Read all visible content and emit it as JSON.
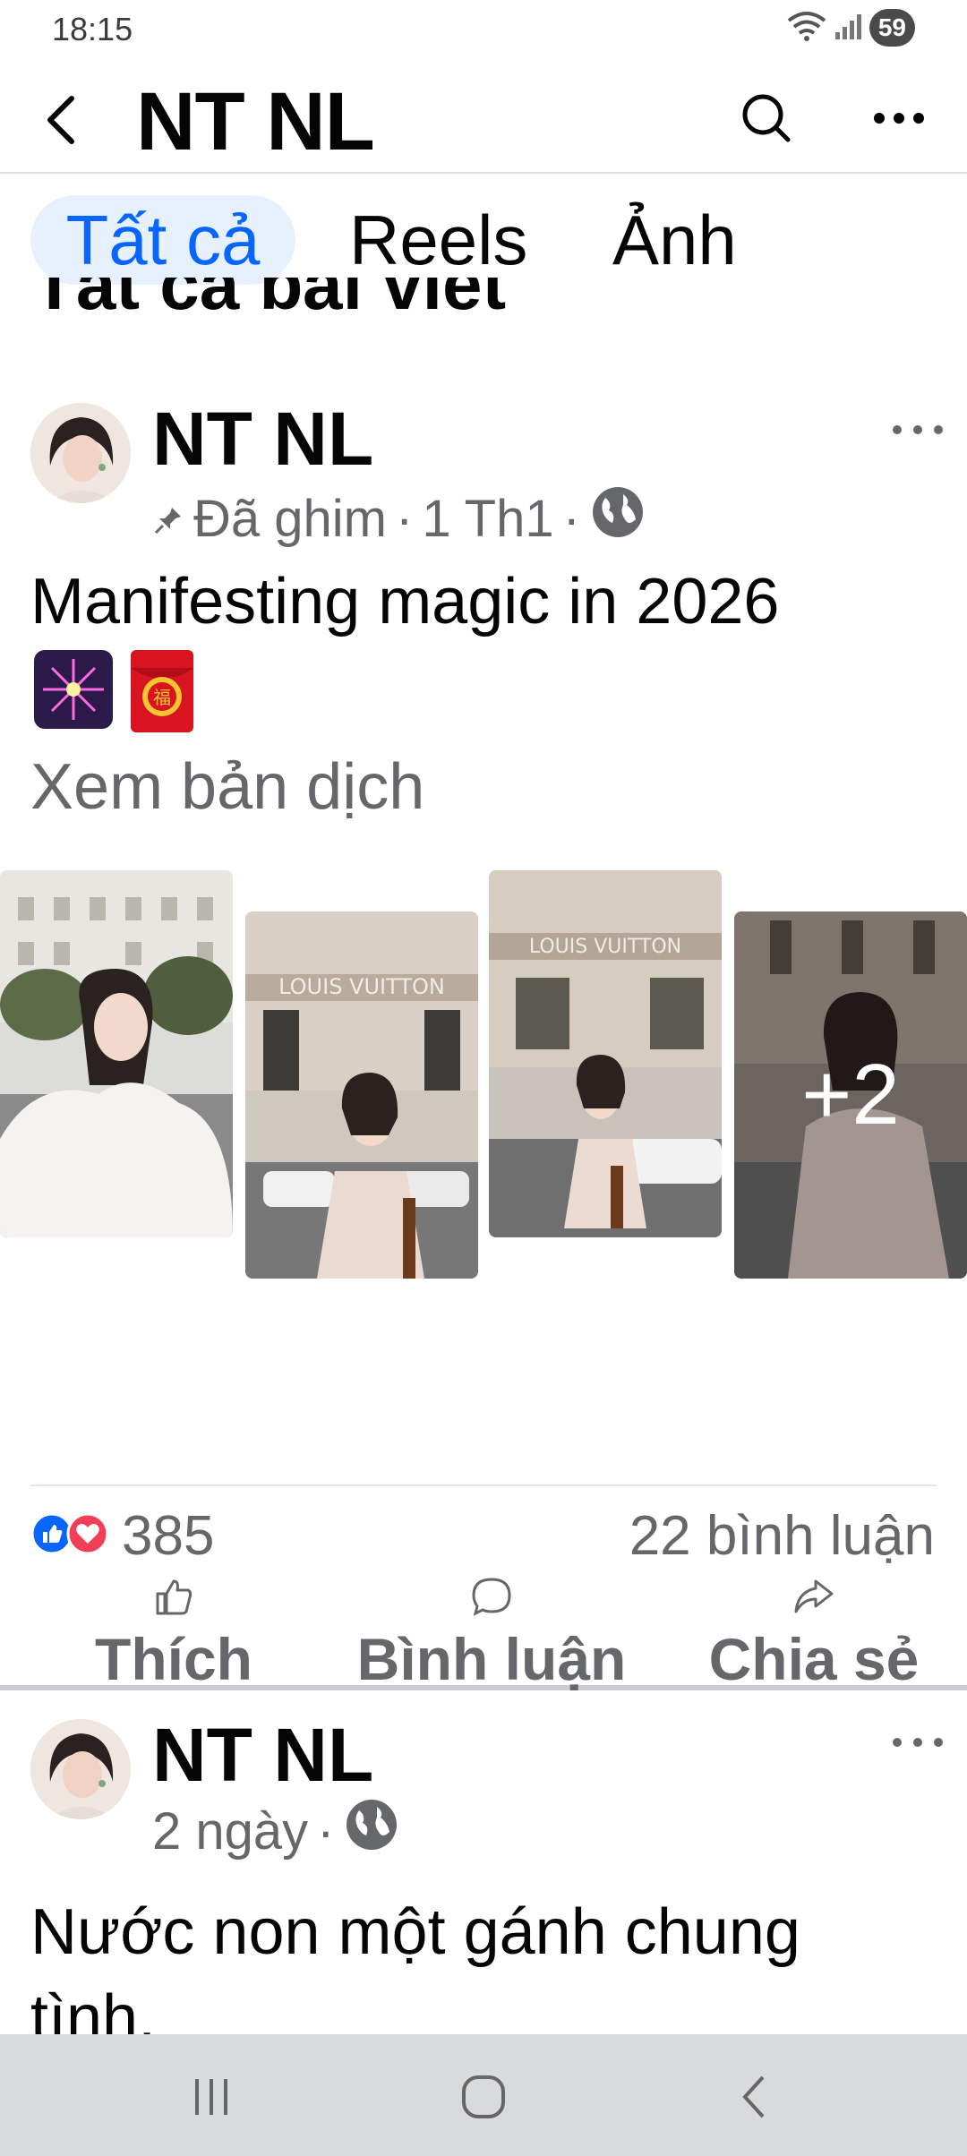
{
  "status": {
    "time": "18:15",
    "battery": "59"
  },
  "header": {
    "title": "NT NL"
  },
  "tabs": [
    {
      "label": "Tất cả"
    },
    {
      "label": "Reels"
    },
    {
      "label": "Ảnh"
    }
  ],
  "section": {
    "title": "Tất cả bài viết"
  },
  "posts": [
    {
      "author": "NT NL",
      "pinned": "Đã ghim",
      "time": "1 Th1",
      "sep": "·",
      "text": "Manifesting magic in 2026",
      "emojis": [
        "fireworks-emoji",
        "red-envelope-emoji"
      ],
      "translate": "Xem bản dịch",
      "more_photos": "+2",
      "reaction_count": "385",
      "comment_count": "22 bình luận",
      "actions": {
        "like": "Thích",
        "comment": "Bình luận",
        "share": "Chia sẻ"
      }
    },
    {
      "author": "NT NL",
      "time": "2 ngày",
      "sep": "·",
      "text": "Nước non một gánh chung tình."
    }
  ],
  "colors": {
    "accent": "#0866ff",
    "tab_active_bg": "#e7f1fd",
    "secondary_text": "#65676b",
    "love": "#f33e58"
  }
}
